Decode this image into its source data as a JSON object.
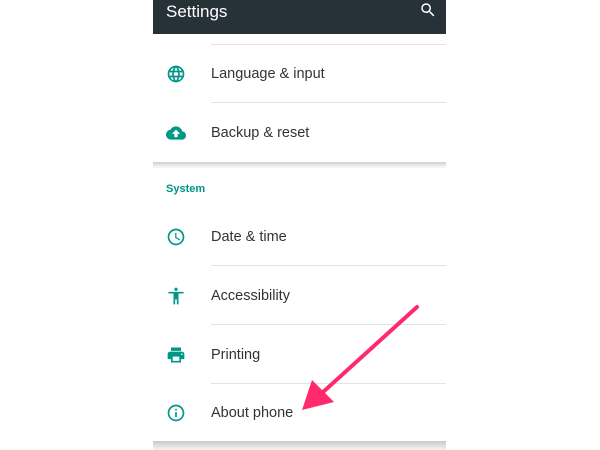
{
  "app_bar": {
    "title": "Settings",
    "search_icon": "search-icon",
    "background": "#263238"
  },
  "accent_color": "#009688",
  "items_top": [
    {
      "label": "Language & input",
      "icon": "globe-icon"
    },
    {
      "label": "Backup & reset",
      "icon": "cloud-upload-icon"
    }
  ],
  "system_section": {
    "header": "System",
    "items": [
      {
        "label": "Date & time",
        "icon": "clock-icon"
      },
      {
        "label": "Accessibility",
        "icon": "accessibility-icon"
      },
      {
        "label": "Printing",
        "icon": "printer-icon"
      },
      {
        "label": "About phone",
        "icon": "info-icon"
      }
    ]
  },
  "annotation": {
    "arrow_color": "#ff2a6d",
    "points_to": "About phone"
  }
}
